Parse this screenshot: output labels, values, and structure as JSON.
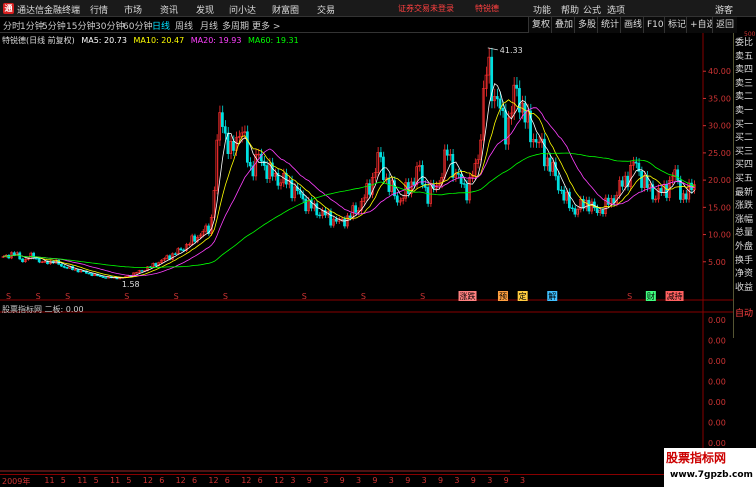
{
  "app": {
    "title": "通达信金融终端",
    "logo": "通"
  },
  "menu": [
    "行情",
    "市场",
    "资讯",
    "发现",
    "问小达",
    "财富圈",
    "交易"
  ],
  "notice": {
    "text": "证券交易未登录",
    "stock": "特锐德"
  },
  "right_menu": [
    "功能",
    "帮助",
    "公式",
    "选项",
    "游客"
  ],
  "periods": [
    {
      "label": "分时",
      "active": false
    },
    {
      "label": "1分钟",
      "active": false
    },
    {
      "label": "5分钟",
      "active": false
    },
    {
      "label": "15分钟",
      "active": false
    },
    {
      "label": "30分钟",
      "active": false
    },
    {
      "label": "60分钟",
      "active": false
    },
    {
      "label": "日线",
      "active": true
    },
    {
      "label": "周线",
      "active": false
    },
    {
      "label": "月线",
      "active": false
    },
    {
      "label": "多周期",
      "active": false
    },
    {
      "label": "更多 >",
      "active": false
    }
  ],
  "tools": [
    "复权",
    "叠加",
    "多股",
    "统计",
    "画线",
    "F10",
    "标记",
    "+自选",
    "返回"
  ],
  "legend": {
    "stock": "特锐德(日线 前复权)",
    "ma5": "MA5: 20.73",
    "ma10": "MA10: 20.47",
    "ma20": "MA20: 19.93",
    "ma60": "MA60: 19.31"
  },
  "sub_legend": "股票指标网 二板: 0.00",
  "right_panel": [
    "委比",
    "卖五",
    "卖四",
    "卖三",
    "卖二",
    "卖一",
    "买一",
    "买二",
    "买三",
    "买四",
    "买五",
    "最新",
    "涨跌",
    "涨幅",
    "总量",
    "外盘",
    "换手",
    "净资",
    "收益"
  ],
  "right_top": "500",
  "auto": "自动",
  "watermark": {
    "name": "股票指标网",
    "url": "www.7gpzb.com"
  },
  "colors": {
    "up": "#ff3030",
    "down": "#00e0e0",
    "ma5": "#ffffff",
    "ma10": "#ffff00",
    "ma20": "#ff40ff",
    "ma60": "#00ff00",
    "axis": "#c33"
  },
  "dates": [
    "2009年",
    "11",
    "5",
    "11",
    "5",
    "11",
    "5",
    "12",
    "6",
    "12",
    "6",
    "12",
    "6",
    "12",
    "6",
    "12",
    "3",
    "9",
    "3",
    "9",
    "3",
    "9",
    "3",
    "9",
    "3",
    "9",
    "3",
    "9",
    "3",
    "9",
    "3"
  ],
  "chart_data": {
    "type": "candlestick",
    "y_ticks": [
      "40.00",
      "35.00",
      "30.00",
      "25.00",
      "20.00",
      "15.00",
      "10.00",
      "5.00"
    ],
    "sub_ticks": [
      "0.00",
      "0.00",
      "0.00",
      "0.00",
      "0.00",
      "0.00",
      "0.00",
      "0.00"
    ],
    "ylim": [
      0,
      45
    ],
    "high_label": "41.33",
    "low_label": "1.58",
    "close_profile": [
      5.5,
      6.5,
      5.0,
      6.0,
      4.5,
      5.0,
      4.0,
      3.5,
      3.0,
      2.5,
      2.0,
      1.9,
      1.8,
      2.5,
      3.2,
      4.0,
      5.0,
      6.0,
      7.0,
      8.5,
      10,
      11,
      33,
      24,
      30,
      22,
      24,
      21,
      20,
      19,
      17,
      15,
      14,
      13,
      12,
      13,
      15,
      18,
      24,
      19,
      16,
      18,
      22,
      17,
      19,
      25,
      20,
      18,
      23,
      41,
      34,
      29,
      37,
      30,
      27,
      24,
      20,
      16,
      14,
      16,
      14,
      15,
      17,
      20,
      23,
      19,
      17,
      18,
      21,
      16,
      20
    ],
    "markers": [
      {
        "label": "S",
        "i": 0
      },
      {
        "label": "S",
        "i": 3
      },
      {
        "label": "S",
        "i": 6
      },
      {
        "label": "S",
        "i": 12
      },
      {
        "label": "S",
        "i": 17
      },
      {
        "label": "S",
        "i": 22
      },
      {
        "label": "S",
        "i": 30
      },
      {
        "label": "S",
        "i": 36
      },
      {
        "label": "S",
        "i": 42
      },
      {
        "label": "涨跌",
        "i": 46
      },
      {
        "label": "预",
        "i": 50
      },
      {
        "label": "定",
        "i": 52
      },
      {
        "label": "解",
        "i": 55
      },
      {
        "label": "S",
        "i": 63
      },
      {
        "label": "财",
        "i": 65
      },
      {
        "label": "减持",
        "i": 67
      }
    ]
  }
}
